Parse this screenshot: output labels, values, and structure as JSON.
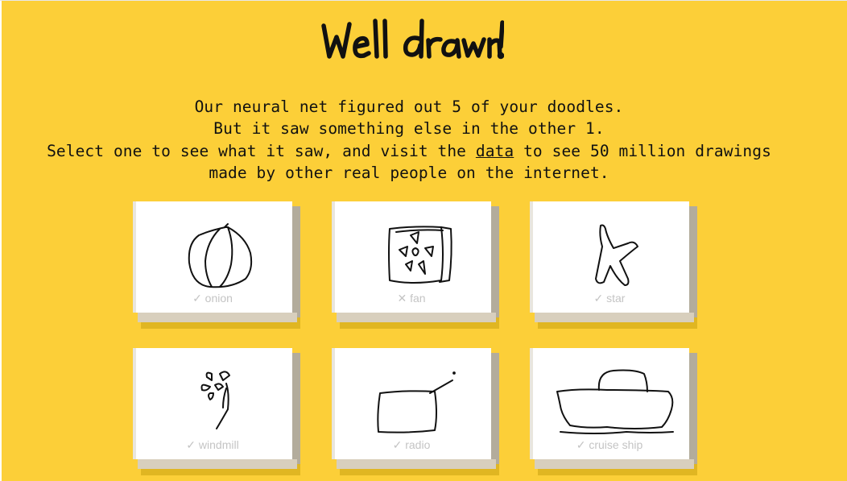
{
  "page": {
    "title": "Well drawn!",
    "intro": {
      "line1": "Our neural net figured out 5 of your doodles.",
      "line2": "But it saw something else in the other 1.",
      "line3_before": "Select one to see what it saw, and visit the",
      "data_link": "data",
      "line3_after": "to see 50 million drawings",
      "line4": "made by other real people on the internet."
    }
  },
  "doodles": [
    {
      "label": "✓ onion",
      "word": "onion",
      "recognized": true,
      "icon": "onion-doodle"
    },
    {
      "label": "✕ fan",
      "word": "fan",
      "recognized": false,
      "icon": "fan-doodle"
    },
    {
      "label": "✓ star",
      "word": "star",
      "recognized": true,
      "icon": "star-doodle"
    },
    {
      "label": "✓ windmill",
      "word": "windmill",
      "recognized": true,
      "icon": "windmill-doodle"
    },
    {
      "label": "✓ radio",
      "word": "radio",
      "recognized": true,
      "icon": "radio-doodle"
    },
    {
      "label": "✓ cruise ship",
      "word": "cruise ship",
      "recognized": true,
      "icon": "cruise-ship-doodle"
    }
  ],
  "colors": {
    "background": "#fccf38",
    "card_face": "#ffffff",
    "label_text": "#c4c4c4",
    "ink": "#111111"
  }
}
